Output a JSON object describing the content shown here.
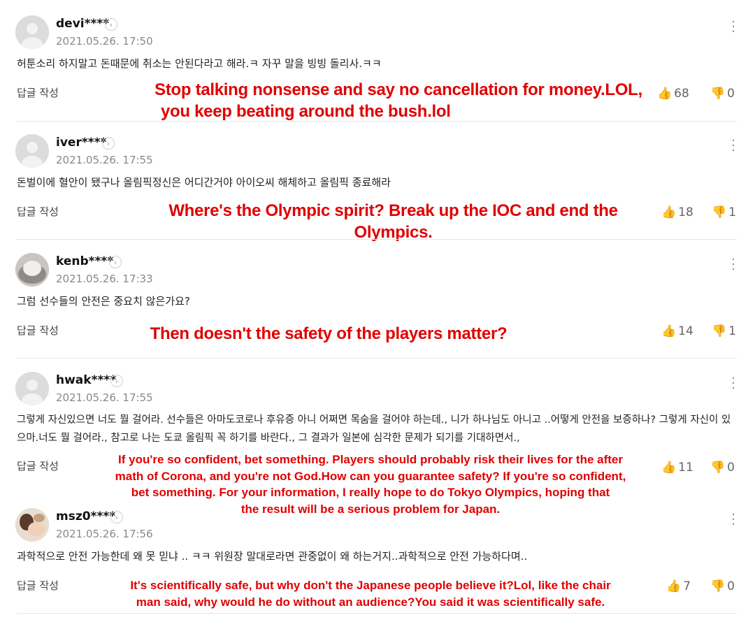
{
  "ui": {
    "reply_label": "답글 작성",
    "more_icon": "more-vertical-icon",
    "like_icon": "thumbs-up-icon",
    "dislike_icon": "thumbs-down-icon",
    "accent_color": "#e00000"
  },
  "comments": [
    {
      "user": "devi****",
      "date": "2021.05.26. 17:50",
      "text": "허툰소리 하지말고 돈때문에 취소는 안된다라고 해라.ㅋ 자꾸 말을 빙빙 돌리사.ㅋㅋ",
      "likes": "68",
      "dislikes": "0",
      "translation": [
        "Stop talking nonsense and say no cancellation for money.LOL,",
        "you keep beating around the bush.lol"
      ]
    },
    {
      "user": "iver****",
      "date": "2021.05.26. 17:55",
      "text": "돈벌이에 혈안이 됐구나 올림픽정신은 어디간거야 아이오씨 해체하고 올림픽 종료해라",
      "likes": "18",
      "dislikes": "1",
      "translation": [
        "Where's the Olympic spirit? Break up the IOC and end the Olympics."
      ]
    },
    {
      "user": "kenb****",
      "date": "2021.05.26. 17:33",
      "text": "그럼 선수들의 안전은 중요치 않은가요?",
      "likes": "14",
      "dislikes": "1",
      "translation": [
        "Then doesn't the safety of the players matter?"
      ]
    },
    {
      "user": "hwak****",
      "date": "2021.05.26. 17:55",
      "text": "그렇게 자신있으면 너도 뭘 걸어라. 선수들은 아마도코로나 후유증 아니 어쩌면 목숨을 걸어야 하는데., 니가 하나님도 아니고 ..어떻게 안전을 보증하나? 그렇게 자신이 있으마.너도 뭘 걸어라., 참고로 나는 도쿄 올림픽 꼭 하기를 바란다., 그 결과가 일본에 심각한 문제가 되기를 기대하면서.,",
      "likes": "11",
      "dislikes": "0",
      "translation": [
        "If you're so confident, bet something. Players should probably risk their lives for the after",
        "math of Corona, and you're not God.How can you guarantee safety? If you're so confident,",
        "bet something. For your information, I really hope to do Tokyo Olympics, hoping that",
        "the result will be a serious problem for Japan."
      ]
    },
    {
      "user": "msz0****",
      "date": "2021.05.26. 17:56",
      "text": "과학적으로 안전 가능한데 왜 못 믿냐 .. ㅋㅋ 위원장 말대로라면 관중없이 왜 하는거지..과학적으로 안전 가능하다며..",
      "likes": "7",
      "dislikes": "0",
      "translation": [
        "It's scientifically safe, but why don't the Japanese people believe it?Lol, like the chair",
        "man said, why would he do without an audience?You said it was scientifically safe."
      ]
    }
  ]
}
